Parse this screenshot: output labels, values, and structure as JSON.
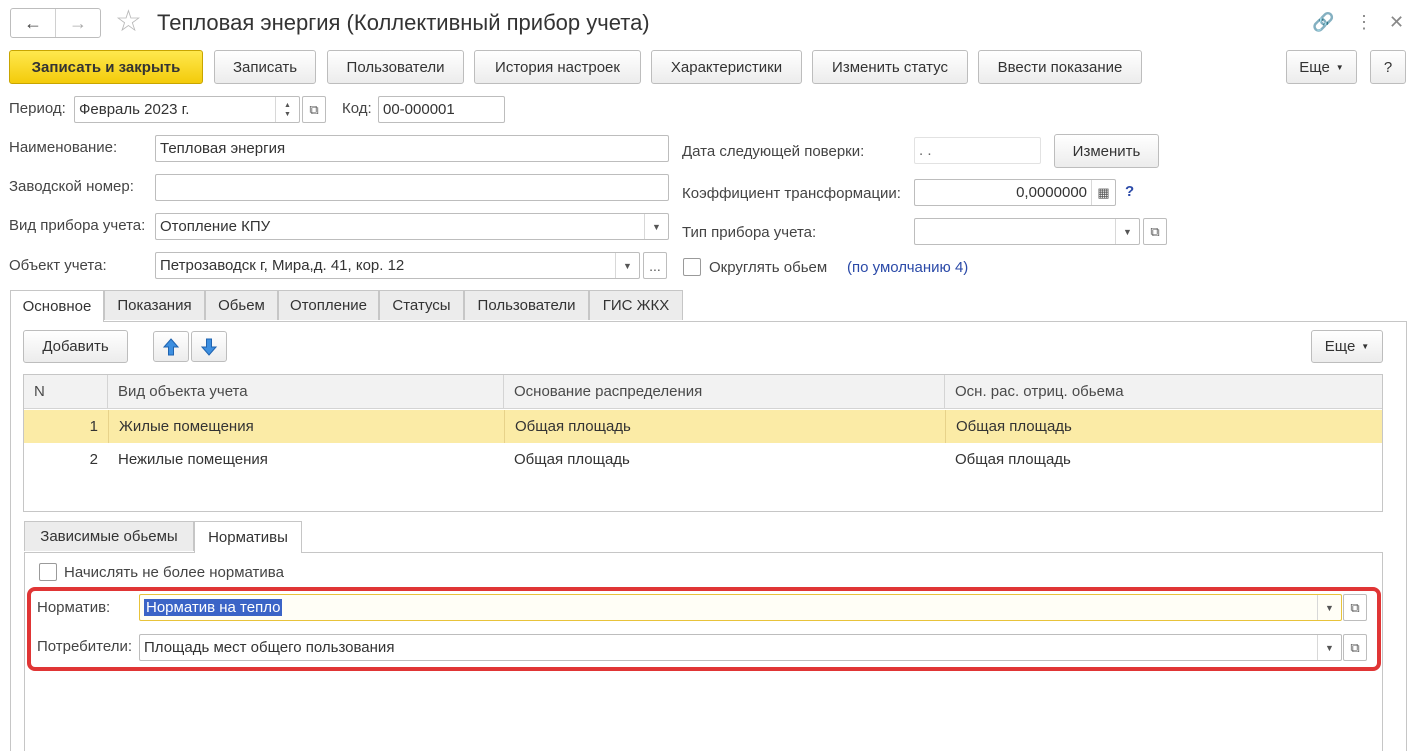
{
  "window": {
    "title": "Тепловая энергия (Коллективный прибор учета)",
    "back_icon": "arrow-left-icon",
    "forward_icon": "arrow-right-icon",
    "favorite_icon": "star-icon",
    "link_icon": "link-icon",
    "menu_icon": "more-vertical-icon",
    "close_icon": "close-icon"
  },
  "toolbar": {
    "save_close": "Записать и закрыть",
    "save": "Записать",
    "users": "Пользователи",
    "history": "История настроек",
    "characteristics": "Характеристики",
    "change_status": "Изменить статус",
    "enter_reading": "Ввести показание",
    "more": "Еще",
    "help": "?"
  },
  "header_fields": {
    "period_label": "Период:",
    "period_value": "Февраль 2023 г.",
    "code_label": "Код:",
    "code_value": "00-000001",
    "name_label": "Наименование:",
    "name_value": "Тепловая энергия",
    "serial_label": "Заводской номер:",
    "serial_value": "",
    "meter_kind_label": "Вид прибора учета:",
    "meter_kind_value": "Отопление КПУ",
    "object_label": "Объект учета:",
    "object_value": "Петрозаводск г, Мира,д. 41, кор. 12",
    "object_select": "...",
    "next_check_label": "Дата следующей поверки:",
    "next_check_value": ". .",
    "change_btn": "Изменить",
    "coef_label": "Коэффициент трансформации:",
    "coef_value": "0,0000000",
    "coef_help": "?",
    "meter_type_label": "Тип прибора учета:",
    "meter_type_value": "",
    "round_label": "Округлять обьем",
    "round_checked": false,
    "round_default_link": "(по умолчанию 4)"
  },
  "tabs": [
    "Основное",
    "Показания",
    "Обьем",
    "Отопление",
    "Статусы",
    "Пользователи",
    "ГИС ЖКХ"
  ],
  "active_tab": 0,
  "main_panel": {
    "add_btn": "Добавить",
    "up_icon": "arrow-up-icon",
    "down_icon": "arrow-down-icon",
    "more": "Еще",
    "columns": [
      "N",
      "Вид объекта учета",
      "Основание распределения",
      "Осн. рас. отриц. обьема"
    ],
    "rows": [
      {
        "n": "1",
        "kind": "Жилые помещения",
        "basis": "Общая площадь",
        "neg_basis": "Общая площадь"
      },
      {
        "n": "2",
        "kind": "Нежилые помещения",
        "basis": "Общая площадь",
        "neg_basis": "Общая площадь"
      }
    ],
    "selected_row": 0
  },
  "sub_tabs": [
    "Зависимые обьемы",
    "Нормативы"
  ],
  "active_sub_tab": 1,
  "norm_panel": {
    "limit_label": "Начислять не более норматива",
    "limit_checked": false,
    "norm_label": "Норматив:",
    "norm_value": "Норматив на тепло",
    "consumers_label": "Потребители:",
    "consumers_value": "Площадь мест общего пользования"
  },
  "colors": {
    "primary_button": "#f3cb0b",
    "selected_row": "#fbeba6",
    "highlight_box": "#e03535",
    "link": "#2b4aa8",
    "text_selection": "#3b64c7"
  }
}
